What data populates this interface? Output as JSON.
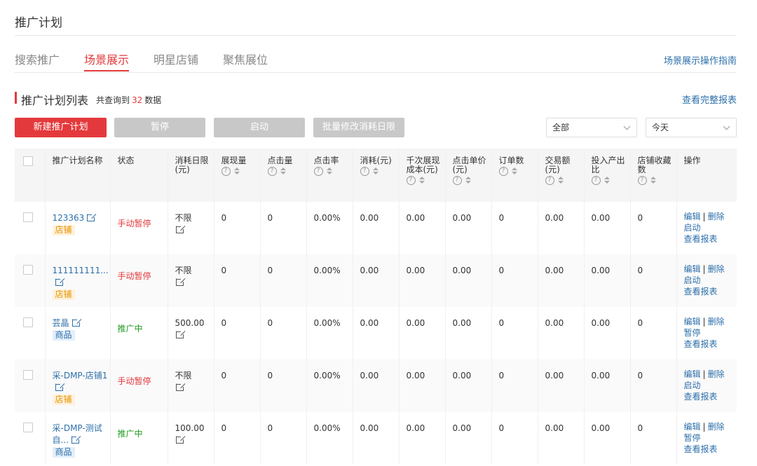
{
  "page": {
    "title": "推广计划"
  },
  "tabs": [
    {
      "label": "搜索推广"
    },
    {
      "label": "场景展示"
    },
    {
      "label": "明星店铺"
    },
    {
      "label": "聚焦展位"
    }
  ],
  "guide_link": "场景展示操作指南",
  "section": {
    "title": "推广计划列表",
    "count_prefix": "共查询到",
    "count": "32",
    "count_suffix": "数据",
    "report_link": "查看完整报表"
  },
  "toolbar": {
    "new_plan": "新建推广计划",
    "pause": "暂停",
    "start": "启动",
    "batch_edit": "批量修改消耗日限"
  },
  "filters": {
    "scope": "全部",
    "date": "今天"
  },
  "table": {
    "headers": {
      "name": "推广计划名称",
      "status": "状态",
      "limit": "消耗日限(元)",
      "impressions": "展现量",
      "clicks": "点击量",
      "ctr": "点击率",
      "cost": "消耗(元)",
      "cpm": "千次展现成本(元)",
      "cpc": "点击单价(元)",
      "orders": "订单数",
      "gmv": "交易额(元)",
      "roi": "投入产出比",
      "favorites": "店铺收藏数",
      "ops": "操作"
    },
    "ops_labels": {
      "edit": "编辑",
      "delete": "删除",
      "report": "查看报表",
      "sep": "|"
    },
    "rows": [
      {
        "name": "123363",
        "tag": "店铺",
        "tag_kind": "shop",
        "status": "手动暂停",
        "status_kind": "paused",
        "limit": "不限",
        "impressions": "0",
        "clicks": "0",
        "ctr": "0.00%",
        "cost": "0.00",
        "cpm": "0.00",
        "cpc": "0.00",
        "orders": "0",
        "gmv": "0.00",
        "roi": "0.00",
        "favorites": "0",
        "toggle": "启动"
      },
      {
        "name": "111111111...",
        "tag": "店铺",
        "tag_kind": "shop",
        "status": "手动暂停",
        "status_kind": "paused",
        "limit": "不限",
        "impressions": "0",
        "clicks": "0",
        "ctr": "0.00%",
        "cost": "0.00",
        "cpm": "0.00",
        "cpc": "0.00",
        "orders": "0",
        "gmv": "0.00",
        "roi": "0.00",
        "favorites": "0",
        "toggle": "启动"
      },
      {
        "name": "芸晶",
        "tag": "商品",
        "tag_kind": "goods",
        "status": "推广中",
        "status_kind": "running",
        "limit": "500.00",
        "impressions": "0",
        "clicks": "0",
        "ctr": "0.00%",
        "cost": "0.00",
        "cpm": "0.00",
        "cpc": "0.00",
        "orders": "0",
        "gmv": "0.00",
        "roi": "0.00",
        "favorites": "0",
        "toggle": "暂停"
      },
      {
        "name": "采-DMP-店铺1",
        "tag": "店铺",
        "tag_kind": "shop",
        "status": "手动暂停",
        "status_kind": "paused",
        "limit": "不限",
        "impressions": "0",
        "clicks": "0",
        "ctr": "0.00%",
        "cost": "0.00",
        "cpm": "0.00",
        "cpc": "0.00",
        "orders": "0",
        "gmv": "0.00",
        "roi": "0.00",
        "favorites": "0",
        "toggle": "启动"
      },
      {
        "name": "采-DMP-测试自...",
        "tag": "商品",
        "tag_kind": "goods",
        "status": "推广中",
        "status_kind": "running",
        "limit": "100.00",
        "impressions": "0",
        "clicks": "0",
        "ctr": "0.00%",
        "cost": "0.00",
        "cpm": "0.00",
        "cpc": "0.00",
        "orders": "0",
        "gmv": "0.00",
        "roi": "0.00",
        "favorites": "0",
        "toggle": "暂停"
      }
    ]
  }
}
